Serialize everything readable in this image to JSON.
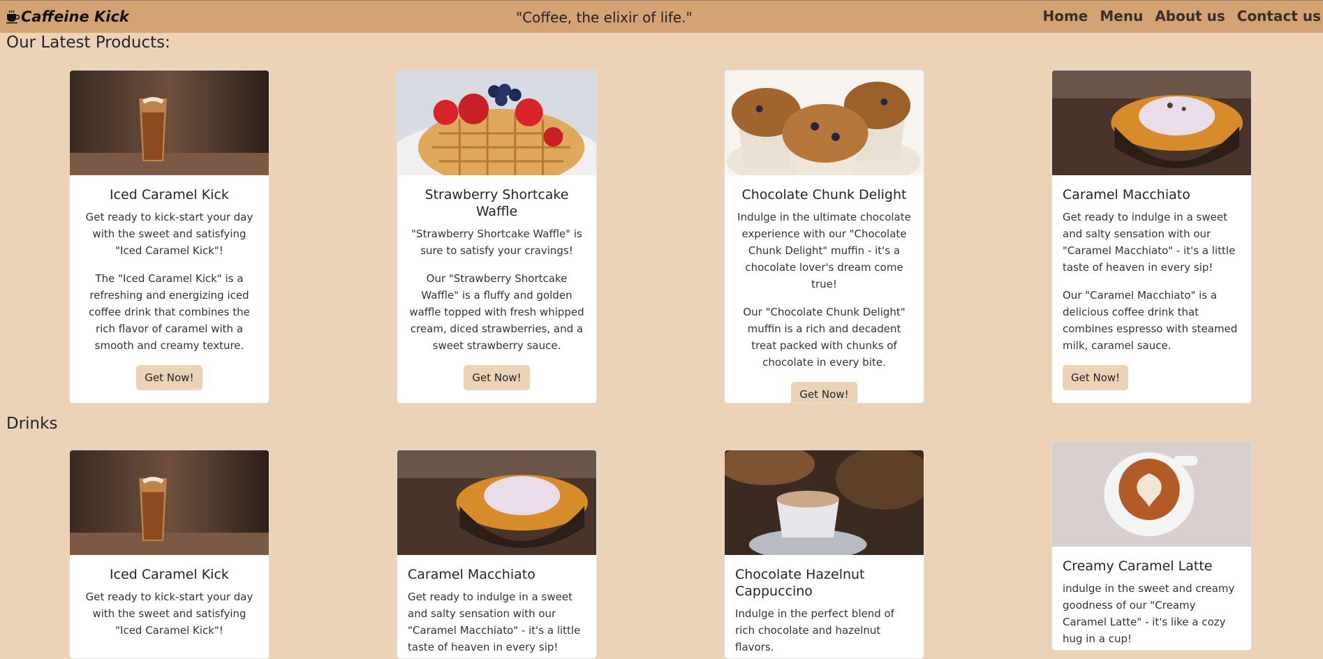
{
  "brand": {
    "name": "Caffeine Kick",
    "icon": "coffee-cup-icon"
  },
  "tagline": "\"Coffee, the elixir of life.\"",
  "nav": [
    "Home",
    "Menu",
    "About us",
    "Contact us"
  ],
  "colors": {
    "navbar": "#d4a373",
    "page_bg": "#ecd3b8",
    "button_bg": "#ecd3b8"
  },
  "latest": {
    "title": "Our Latest Products:",
    "cards": [
      {
        "title": "Iced Caramel Kick",
        "p1": "Get ready to kick-start your day with the sweet and satisfying \"Iced Caramel Kick\"!",
        "p2": "The \"Iced Caramel Kick\" is a refreshing and energizing iced coffee drink that combines the rich flavor of caramel with a smooth and creamy texture.",
        "button": "Get Now!",
        "image": "iced-caramel-coffee-photo"
      },
      {
        "title": "Strawberry Shortcake Waffle",
        "p1": "\"Strawberry Shortcake Waffle\" is sure to satisfy your cravings!",
        "p2": "Our \"Strawberry Shortcake Waffle\" is a fluffy and golden waffle topped with fresh whipped cream, diced strawberries, and a sweet strawberry sauce.",
        "button": "Get Now!",
        "image": "strawberry-waffle-photo"
      },
      {
        "title": "Chocolate Chunk Delight",
        "p1": "Indulge in the ultimate chocolate experience with our \"Chocolate Chunk Delight\" muffin - it's a chocolate lover's dream come true!",
        "p2": "Our \"Chocolate Chunk Delight\" muffin is a rich and decadent treat packed with chunks of chocolate in every bite.",
        "button": "Get Now!",
        "image": "muffins-photo"
      },
      {
        "title": "Caramel Macchiato",
        "p1": "Get ready to indulge in a sweet and salty sensation with our \"Caramel Macchiato\" - it's a little taste of heaven in every sip!",
        "p2": "Our \"Caramel Macchiato\" is a delicious coffee drink that combines espresso with steamed milk, caramel sauce.",
        "button": "Get Now!",
        "image": "caramel-macchiato-photo"
      }
    ]
  },
  "drinks": {
    "title": "Drinks",
    "cards": [
      {
        "title": "Iced Caramel Kick",
        "p1": "Get ready to kick-start your day with the sweet and satisfying \"Iced Caramel Kick\"!",
        "image": "iced-caramel-coffee-photo"
      },
      {
        "title": "Caramel Macchiato",
        "p1": "Get ready to indulge in a sweet and salty sensation with our \"Caramel Macchiato\" - it's a little taste of heaven in every sip!",
        "image": "caramel-macchiato-photo"
      },
      {
        "title": "Chocolate Hazelnut Cappuccino",
        "p1": "Indulge in the perfect blend of rich chocolate and hazelnut flavors.",
        "image": "cappuccino-photo"
      },
      {
        "title": "Creamy Caramel Latte",
        "p1": "indulge in the sweet and creamy goodness of our \"Creamy Caramel Latte\" - it's like a cozy hug in a cup!",
        "image": "latte-art-photo"
      }
    ]
  }
}
